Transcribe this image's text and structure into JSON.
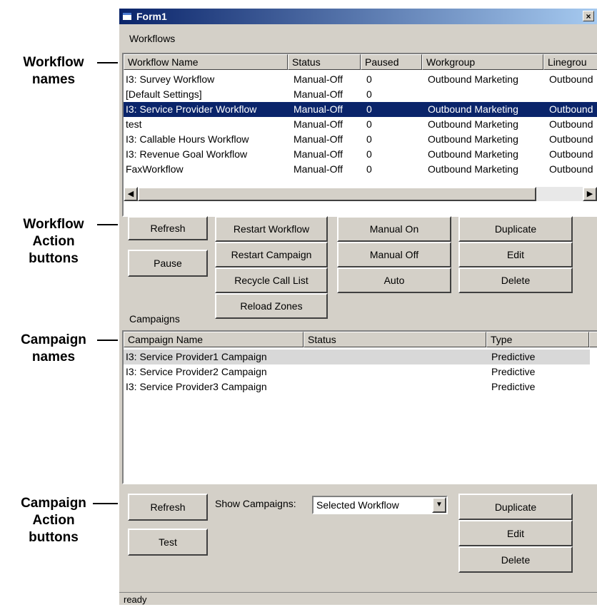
{
  "callouts": {
    "workflow_names": [
      "Workflow",
      "names"
    ],
    "workflow_actions": [
      "Workflow",
      "Action",
      "buttons"
    ],
    "campaign_names": [
      "Campaign",
      "names"
    ],
    "campaign_actions": [
      "Campaign",
      "Action",
      "buttons"
    ]
  },
  "window": {
    "title": "Form1",
    "close": "×"
  },
  "workflows": {
    "label": "Workflows",
    "columns": [
      "Workflow Name",
      "Status",
      "Paused",
      "Workgroup",
      "Linegrou"
    ],
    "rows": [
      [
        "I3: Survey Workflow",
        "Manual-Off",
        "0",
        "Outbound Marketing",
        "Outbound"
      ],
      [
        "[Default Settings]",
        "Manual-Off",
        "0",
        "",
        ""
      ],
      [
        "I3: Service Provider Workflow",
        "Manual-Off",
        "0",
        "Outbound Marketing",
        "Outbound"
      ],
      [
        "test",
        "Manual-Off",
        "0",
        "Outbound Marketing",
        "Outbound"
      ],
      [
        "I3: Callable Hours Workflow",
        "Manual-Off",
        "0",
        "Outbound Marketing",
        "Outbound"
      ],
      [
        "I3: Revenue Goal Workflow",
        "Manual-Off",
        "0",
        "Outbound Marketing",
        "Outbound"
      ],
      [
        "FaxWorkflow",
        "Manual-Off",
        "0",
        "Outbound Marketing",
        "Outbound"
      ]
    ],
    "selected_row": 2,
    "scroll_left": "◀",
    "scroll_right": "▶"
  },
  "workflow_buttons": {
    "refresh": "Refresh",
    "pause": "Pause",
    "restart_workflow": "Restart Workflow",
    "restart_campaign": "Restart Campaign",
    "recycle_call_list": "Recycle Call List",
    "reload_zones": "Reload Zones",
    "manual_on": "Manual On",
    "manual_off": "Manual Off",
    "auto": "Auto",
    "duplicate": "Duplicate",
    "edit": "Edit",
    "delete": "Delete"
  },
  "campaigns": {
    "label": "Campaigns",
    "columns": [
      "Campaign Name",
      "Status",
      "Type"
    ],
    "rows": [
      [
        "I3: Service Provider1 Campaign",
        "",
        "Predictive"
      ],
      [
        "I3: Service Provider2 Campaign",
        "",
        "Predictive"
      ],
      [
        "I3: Service Provider3 Campaign",
        "",
        "Predictive"
      ]
    ]
  },
  "campaign_buttons": {
    "refresh": "Refresh",
    "test": "Test",
    "show_label": "Show Campaigns:",
    "show_value": "Selected Workflow",
    "dropdown_arrow": "▼",
    "duplicate": "Duplicate",
    "edit": "Edit",
    "delete": "Delete"
  },
  "status": "ready"
}
